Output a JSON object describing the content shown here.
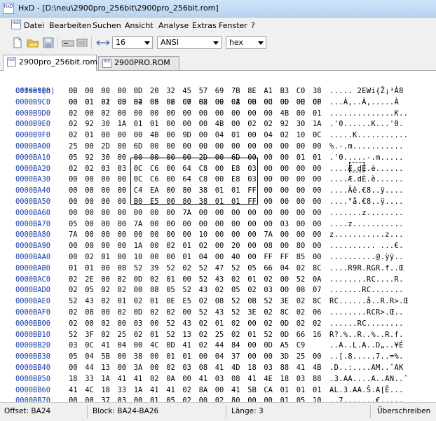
{
  "window": {
    "title": "HxD - [D:\\neu\\2900pro_256bit\\2900pro_256bit.rom]",
    "icon_label": "HxD"
  },
  "menu": {
    "items": [
      "Datei",
      "Bearbeiten",
      "Suchen",
      "Ansicht",
      "Analyse",
      "Extras",
      "Fenster",
      "?"
    ]
  },
  "toolbar": {
    "bytes_per_row": "16",
    "charset": "ANSI",
    "display_mode": "hex",
    "icons": [
      "new-file-icon",
      "open-folder-icon",
      "save-icon",
      "disk-drive-icon",
      "memory-icon",
      "bytes-per-row-icon"
    ]
  },
  "tabs": [
    {
      "label": "2900pro_256bit.rom",
      "active": true
    },
    {
      "label": "2900PRO.ROM",
      "active": false
    }
  ],
  "editor": {
    "header_offset": "Offset(h)",
    "header_columns": [
      "00",
      "01",
      "02",
      "03",
      "04",
      "05",
      "06",
      "07",
      "08",
      "09",
      "0A",
      "0B",
      "0C",
      "0D",
      "0E",
      "0F"
    ],
    "rows": [
      {
        "offset": "0000B9B0",
        "hex": [
          "0B",
          "00",
          "00",
          "00",
          "0D",
          "20",
          "32",
          "45",
          "57",
          "69",
          "7B",
          "8E",
          "A1",
          "B3",
          "C0",
          "38"
        ],
        "ascii": "..... 2EWi{Ž¡³À8"
      },
      {
        "offset": "0000B9C0",
        "hex": [
          "00",
          "01",
          "01",
          "C0",
          "82",
          "00",
          "02",
          "C0",
          "82",
          "00",
          "02",
          "00",
          "00",
          "00",
          "00",
          "C0"
        ],
        "ascii": "...À‚..À‚.....À"
      },
      {
        "offset": "0000B9D0",
        "hex": [
          "02",
          "00",
          "02",
          "00",
          "00",
          "00",
          "00",
          "00",
          "00",
          "00",
          "00",
          "00",
          "00",
          "4B",
          "00",
          "01"
        ],
        "ascii": "..............K.."
      },
      {
        "offset": "0000B9E0",
        "hex": [
          "02",
          "92",
          "30",
          "1A",
          "01",
          "01",
          "00",
          "00",
          "00",
          "4B",
          "00",
          "02",
          "02",
          "92",
          "30",
          "1A"
        ],
        "ascii": ".'0......K...'0."
      },
      {
        "offset": "0000B9F0",
        "hex": [
          "02",
          "01",
          "00",
          "00",
          "00",
          "4B",
          "00",
          "9D",
          "00",
          "04",
          "01",
          "00",
          "04",
          "02",
          "10",
          "0C"
        ],
        "ascii": ".....K..........."
      },
      {
        "offset": "0000BA00",
        "hex": [
          "25",
          "00",
          "2D",
          "00",
          "6D",
          "00",
          "00",
          "00",
          "00",
          "00",
          "00",
          "00",
          "00",
          "00",
          "00",
          "00"
        ],
        "ascii": "%.-.m..........."
      },
      {
        "offset": "0000BA10",
        "hex": [
          "05",
          "92",
          "30",
          "00",
          "00",
          "00",
          "00",
          "00",
          "2D",
          "00",
          "6D",
          "00",
          "00",
          "00",
          "01",
          "01"
        ],
        "ascii": ".'0.....-.m....."
      },
      {
        "offset": "0000BA20",
        "hex": [
          "02",
          "02",
          "03",
          "03",
          "0C",
          "C6",
          "00",
          "64",
          "C8",
          "00",
          "E8",
          "03",
          "00",
          "00",
          "00",
          "00"
        ],
        "ascii": "....Æ.dÈ.è......"
      },
      {
        "offset": "0000BA30",
        "hex": [
          "00",
          "00",
          "00",
          "00",
          "0C",
          "C6",
          "00",
          "64",
          "C8",
          "00",
          "E8",
          "03",
          "00",
          "00",
          "00",
          "00"
        ],
        "ascii": "....Æ.dÈ.è......"
      },
      {
        "offset": "0000BA40",
        "hex": [
          "00",
          "00",
          "00",
          "00",
          "C4",
          "EA",
          "00",
          "80",
          "38",
          "01",
          "01",
          "FF",
          "00",
          "00",
          "00",
          "00"
        ],
        "ascii": "....Äê.€8..ÿ...."
      },
      {
        "offset": "0000BA50",
        "hex": [
          "00",
          "00",
          "00",
          "00",
          "B0",
          "E5",
          "00",
          "80",
          "38",
          "01",
          "01",
          "FF",
          "00",
          "00",
          "00",
          "00"
        ],
        "ascii": "....°å.€8..ÿ...."
      },
      {
        "offset": "0000BA60",
        "hex": [
          "00",
          "00",
          "00",
          "00",
          "00",
          "00",
          "00",
          "7A",
          "00",
          "00",
          "00",
          "00",
          "00",
          "00",
          "00",
          "00"
        ],
        "ascii": ".......z........"
      },
      {
        "offset": "0000BA70",
        "hex": [
          "05",
          "00",
          "00",
          "00",
          "7A",
          "00",
          "00",
          "00",
          "00",
          "00",
          "00",
          "00",
          "00",
          "03",
          "00",
          "00"
        ],
        "ascii": "....z..........."
      },
      {
        "offset": "0000BA80",
        "hex": [
          "7A",
          "00",
          "00",
          "00",
          "00",
          "00",
          "00",
          "00",
          "10",
          "00",
          "00",
          "00",
          "7A",
          "00",
          "00",
          "00"
        ],
        "ascii": "z...........z..."
      },
      {
        "offset": "0000BA90",
        "hex": [
          "00",
          "00",
          "00",
          "00",
          "1A",
          "00",
          "02",
          "01",
          "02",
          "00",
          "20",
          "00",
          "08",
          "00",
          "80",
          "00"
        ],
        "ascii": ".......... ...€."
      },
      {
        "offset": "0000BAA0",
        "hex": [
          "00",
          "02",
          "01",
          "00",
          "10",
          "00",
          "00",
          "01",
          "04",
          "00",
          "40",
          "00",
          "FF",
          "FF",
          "85",
          "00"
        ],
        "ascii": "..........@.ÿÿ.."
      },
      {
        "offset": "0000BAB0",
        "hex": [
          "01",
          "01",
          "00",
          "08",
          "52",
          "39",
          "52",
          "02",
          "52",
          "47",
          "52",
          "05",
          "66",
          "04",
          "02",
          "8C"
        ],
        "ascii": "....R9R.RGR.f..Œ"
      },
      {
        "offset": "0000BAC0",
        "hex": [
          "02",
          "2E",
          "00",
          "02",
          "0D",
          "02",
          "01",
          "00",
          "52",
          "43",
          "02",
          "01",
          "02",
          "00",
          "52",
          "0A"
        ],
        "ascii": "........RC....R."
      },
      {
        "offset": "0000BAD0",
        "hex": [
          "02",
          "05",
          "02",
          "02",
          "00",
          "08",
          "05",
          "52",
          "43",
          "02",
          "05",
          "02",
          "03",
          "00",
          "08",
          "07"
        ],
        "ascii": ".......RC......."
      },
      {
        "offset": "0000BAE0",
        "hex": [
          "52",
          "43",
          "02",
          "01",
          "02",
          "01",
          "0E",
          "E5",
          "02",
          "08",
          "52",
          "0B",
          "52",
          "3E",
          "02",
          "8C"
        ],
        "ascii": "RC......å..R.R>.Œ"
      },
      {
        "offset": "0000BAF0",
        "hex": [
          "02",
          "08",
          "00",
          "02",
          "0D",
          "02",
          "02",
          "00",
          "52",
          "43",
          "52",
          "3E",
          "02",
          "8C",
          "02",
          "06"
        ],
        "ascii": "........RCR>.Œ.."
      },
      {
        "offset": "0000BB00",
        "hex": [
          "02",
          "00",
          "02",
          "00",
          "03",
          "00",
          "52",
          "43",
          "02",
          "01",
          "02",
          "00",
          "02",
          "0D",
          "02",
          "02"
        ],
        "ascii": "......RC........"
      },
      {
        "offset": "0000BB10",
        "hex": [
          "52",
          "3F",
          "02",
          "25",
          "02",
          "01",
          "52",
          "13",
          "02",
          "25",
          "02",
          "01",
          "52",
          "0D",
          "66",
          "16"
        ],
        "ascii": "R?.%..R..%..R.f."
      },
      {
        "offset": "0000BB20",
        "hex": [
          "03",
          "0C",
          "41",
          "04",
          "00",
          "4C",
          "0D",
          "41",
          "02",
          "44",
          "84",
          "00",
          "0D",
          "A5",
          "C9"
        ],
        "ascii": "..A..L.A..D„..¥É"
      },
      {
        "offset": "0000BB30",
        "hex": [
          "05",
          "04",
          "5B",
          "00",
          "38",
          "00",
          "01",
          "01",
          "00",
          "04",
          "37",
          "00",
          "00",
          "3D",
          "25",
          "00"
        ],
        "ascii": "..[.8.....7..=%."
      },
      {
        "offset": "0000BB40",
        "hex": [
          "00",
          "44",
          "13",
          "00",
          "3A",
          "00",
          "02",
          "03",
          "08",
          "41",
          "4D",
          "18",
          "03",
          "88",
          "41",
          "4B"
        ],
        "ascii": ".D..:....AM..ˆAK"
      },
      {
        "offset": "0000BB50",
        "hex": [
          "18",
          "33",
          "1A",
          "41",
          "41",
          "02",
          "0A",
          "00",
          "41",
          "03",
          "08",
          "41",
          "4E",
          "18",
          "03",
          "88"
        ],
        "ascii": ".3.AA....A..AN..ˆ"
      },
      {
        "offset": "0000BB60",
        "hex": [
          "41",
          "4C",
          "18",
          "33",
          "1A",
          "41",
          "41",
          "02",
          "8A",
          "00",
          "41",
          "5B",
          "CA",
          "01",
          "01",
          "01"
        ],
        "ascii": "AL.3.AA.Š.A[Ê..."
      },
      {
        "offset": "0000BB70",
        "hex": [
          "00",
          "00",
          "37",
          "03",
          "00",
          "01",
          "05",
          "02",
          "00",
          "02",
          "80",
          "00",
          "00",
          "01",
          "05",
          "10"
        ],
        "ascii": "..7.......€....."
      },
      {
        "offset": "0000BB80",
        "hex": [
          "00",
          "00",
          "04",
          "00",
          "00",
          "00",
          "00",
          "00",
          "00",
          "00",
          "00",
          "00",
          "00",
          "00",
          "00",
          "00"
        ],
        "ascii": "................"
      }
    ]
  },
  "status": {
    "offset": "Offset: BA24",
    "block": "Block: BA24-BA26",
    "length": "Länge: 3",
    "mode": "Überschreiben"
  }
}
